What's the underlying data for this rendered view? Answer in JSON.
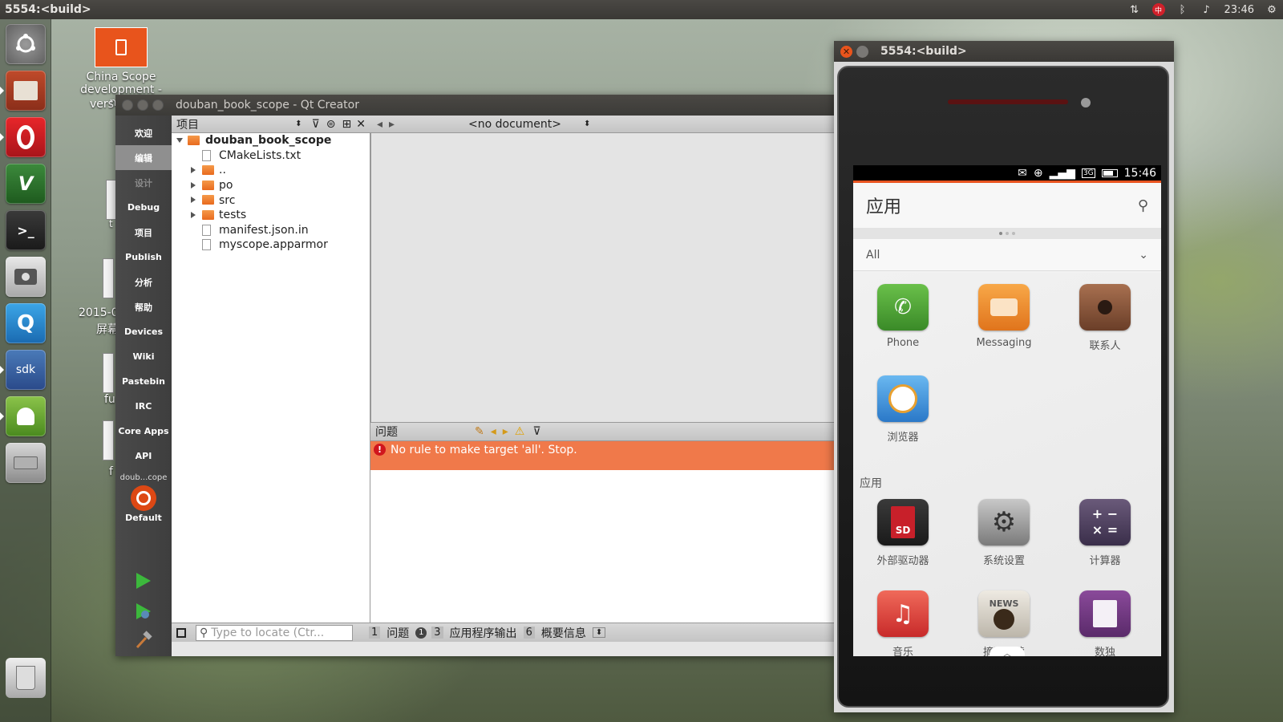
{
  "top_panel": {
    "title": "5554:<build>",
    "clock": "23:46"
  },
  "launcher": {
    "items": [
      "ubuntu-dash",
      "files",
      "opera",
      "vim",
      "terminal",
      "screenshot",
      "qq",
      "sdk",
      "android",
      "drive",
      "trash"
    ],
    "sdk_label": "sdk"
  },
  "desktop": {
    "icon_label_1": "China Scope",
    "icon_label_2": "development - new",
    "icon_label_3": "vers",
    "side_text_1": "2015-0",
    "side_text_2": "屏幕",
    "side_text_3": "fu",
    "side_text_4": "f",
    "side_text_5": "t"
  },
  "qt": {
    "title": "douban_book_scope - Qt Creator",
    "modes": [
      "欢迎",
      "编辑",
      "设计",
      "Debug",
      "项目",
      "Publish",
      "分析",
      "帮助",
      "Devices",
      "Wiki",
      "Pastebin",
      "IRC",
      "Core Apps",
      "API"
    ],
    "kit_project": "doub...cope",
    "kit_label": "Default",
    "project_header": "项目",
    "tree": [
      {
        "name": "douban_book_scope",
        "kind": "root"
      },
      {
        "name": "CMakeLists.txt",
        "kind": "file"
      },
      {
        "name": "..",
        "kind": "folder"
      },
      {
        "name": "po",
        "kind": "folder"
      },
      {
        "name": "src",
        "kind": "folder"
      },
      {
        "name": "tests",
        "kind": "folder"
      },
      {
        "name": "manifest.json.in",
        "kind": "file"
      },
      {
        "name": "myscope.apparmor",
        "kind": "file"
      }
    ],
    "document_combo": "<no document>",
    "issues_title": "问题",
    "issue_message": "No rule to make target 'all'.  Stop.",
    "locate_placeholder": "Type to locate (Ctr...",
    "output_tabs": [
      {
        "num": "1",
        "label": "问题",
        "badge": "1"
      },
      {
        "num": "3",
        "label": "应用程序输出"
      },
      {
        "num": "6",
        "label": "概要信息"
      }
    ]
  },
  "emulator": {
    "title": "5554:<build>",
    "phone_time": "15:46",
    "header_title": "应用",
    "filter_label": "All",
    "apps_top": [
      {
        "label": "Phone",
        "color": "#4aa43c",
        "icon": "phone-icon"
      },
      {
        "label": "Messaging",
        "color": "#f08a2c",
        "icon": "messaging-icon"
      },
      {
        "label": "联系人",
        "color": "#8b5a3c",
        "icon": "contacts-icon"
      },
      {
        "label": "浏览器",
        "color": "#3a8fd6",
        "icon": "browser-icon"
      }
    ],
    "section_label": "应用",
    "apps_bottom": [
      {
        "label": "外部驱动器",
        "color": "#2a2a2a",
        "icon": "sd-card-icon",
        "glyph": "SD"
      },
      {
        "label": "系统设置",
        "color": "#8a8a8a",
        "icon": "settings-icon"
      },
      {
        "label": "计算器",
        "color": "#5a4a6a",
        "icon": "calculator-icon"
      },
      {
        "label": "音乐",
        "color": "#e0453a",
        "icon": "music-icon"
      },
      {
        "label": "摘要阅读",
        "color": "#d9d4cc",
        "icon": "news-icon",
        "glyph": "NEWS"
      },
      {
        "label": "数独",
        "color": "#6a3a7a",
        "icon": "sudoku-icon"
      }
    ]
  }
}
